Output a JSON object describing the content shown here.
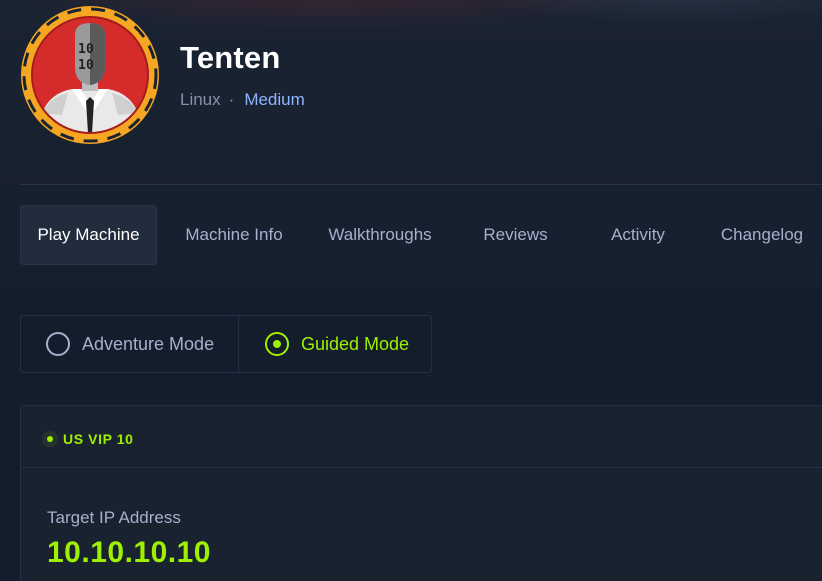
{
  "machine": {
    "name": "Tenten",
    "os": "Linux",
    "separator": "·",
    "difficulty": "Medium"
  },
  "tabs": [
    {
      "label": "Play Machine",
      "active": true
    },
    {
      "label": "Machine Info",
      "active": false
    },
    {
      "label": "Walkthroughs",
      "active": false
    },
    {
      "label": "Reviews",
      "active": false
    },
    {
      "label": "Activity",
      "active": false
    },
    {
      "label": "Changelog",
      "active": false
    }
  ],
  "modes": {
    "adventure_label": "Adventure Mode",
    "guided_label": "Guided Mode",
    "selected": "guided"
  },
  "connection": {
    "server": "US VIP 10",
    "target_label": "Target IP Address",
    "target_ip": "10.10.10.10"
  },
  "colors": {
    "background": "#141d2b",
    "accent_green": "#9fef00",
    "difficulty_medium": "#8db4ff",
    "avatar_ring": "#f5a623",
    "avatar_bg": "#d62b2b"
  },
  "icons": {
    "avatar": "hacker-avatar-icon",
    "radio_off": "radio-unchecked-icon",
    "radio_on": "radio-checked-icon",
    "server_status": "status-dot-icon"
  }
}
